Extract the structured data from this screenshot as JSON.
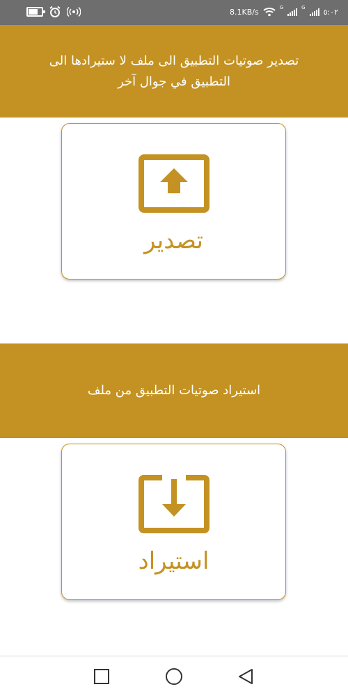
{
  "status_bar": {
    "speed": "8.1KB/s",
    "time": "٥:٠٢",
    "sim1_label": "G",
    "sim2_label": "G"
  },
  "export_section": {
    "description": "تصدير صوتيات التطبيق الى ملف لا ستيرادها الى التطبيق في جوال آخر",
    "button_label": "تصدير",
    "icon": "export-upload-icon"
  },
  "import_section": {
    "description": "استيراد صوتيات التطبيق من ملف",
    "button_label": "استيراد",
    "icon": "import-download-icon"
  },
  "nav_bar": {
    "recents_icon": "square-icon",
    "home_icon": "circle-icon",
    "back_icon": "triangle-back-icon"
  },
  "colors": {
    "accent": "#c49222",
    "status_bar": "#6e6e6e",
    "background": "#ffffff"
  }
}
